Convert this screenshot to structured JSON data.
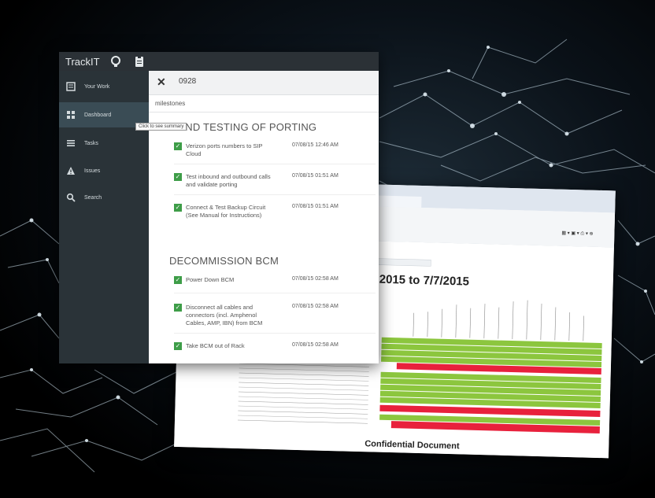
{
  "app": {
    "brand": "TrackIT",
    "header_icons": [
      "lightbulb-icon",
      "clipboard-icon"
    ]
  },
  "sidebar": {
    "items": [
      {
        "label": "Your Work",
        "icon": "your-work-icon"
      },
      {
        "label": "Dashboard",
        "icon": "dashboard-icon",
        "active": true
      },
      {
        "label": "Tasks",
        "icon": "tasks-icon"
      },
      {
        "label": "Issues",
        "icon": "warning-icon"
      },
      {
        "label": "Search",
        "icon": "search-icon"
      }
    ]
  },
  "panel": {
    "title": "0928",
    "subtitle": "milestones",
    "tooltip": "Click to see summary",
    "sections": [
      {
        "heading": "G AND TESTING OF PORTING",
        "tasks": [
          {
            "name": "Verizon ports numbers to SIP Cloud",
            "time": "07/08/15 12:46 AM",
            "done": true
          },
          {
            "name": "Test inbound and outbound calls and validate porting",
            "time": "07/08/15 01:51 AM",
            "done": true
          },
          {
            "name": "Connect & Test Backup Circuit (See Manual for Instructions)",
            "time": "07/08/15 01:51 AM",
            "done": true
          }
        ]
      },
      {
        "heading": "DECOMMISSION BCM",
        "tasks": [
          {
            "name": "Power Down BCM",
            "time": "07/08/15 02:58 AM",
            "done": true
          },
          {
            "name": "Disconnect all cables and connectors (incl. Amphenol Cables, AMP, IBN) from BCM",
            "time": "07/08/15 02:58 AM",
            "done": true
          },
          {
            "name": "Take BCM out of Rack",
            "time": "07/08/15 02:58 AM",
            "done": true
          }
        ]
      }
    ]
  },
  "doc": {
    "title": "2015 to 7/7/2015",
    "footer": "Confidential Document",
    "colors": {
      "green": "#8cc63e",
      "red": "#e8213c"
    }
  },
  "colors": {
    "sidebar": "#2a3338",
    "topbar": "#2b3136",
    "sidebar_active": "#3a4c55",
    "check": "#3e9d48"
  }
}
